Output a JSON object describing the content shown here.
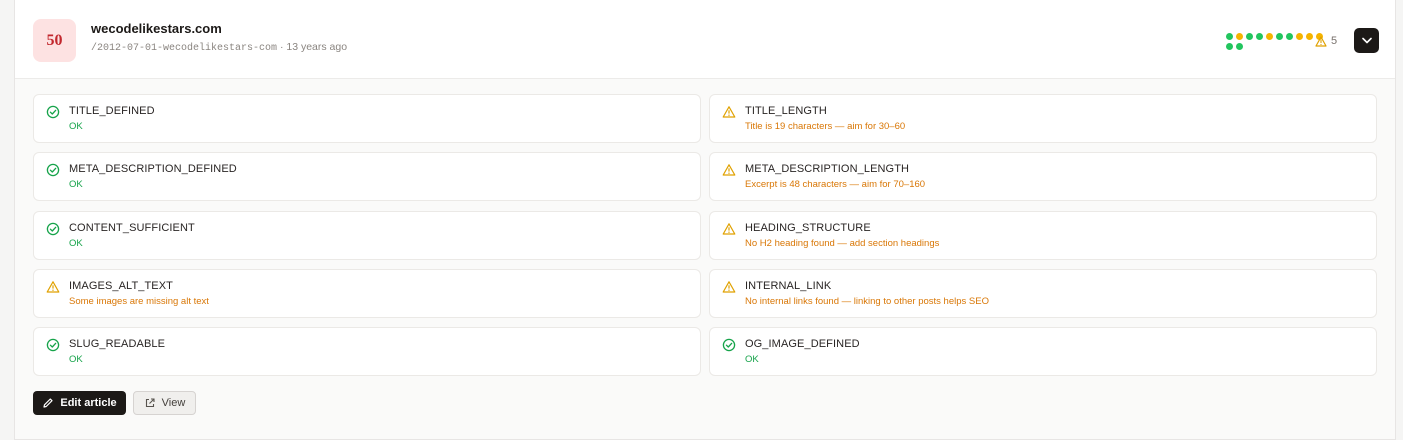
{
  "post": {
    "score": "50",
    "title": "wecodelikestars.com",
    "path": "/2012-07-01-wecodelikestars-com",
    "age": "· 13 years ago",
    "warning_count": "5"
  },
  "status_dots": [
    "ok",
    "warn",
    "ok",
    "ok",
    "warn",
    "ok",
    "ok",
    "warn",
    "warn",
    "warn",
    "ok",
    "ok"
  ],
  "colors": {
    "ok": "#22c55e",
    "warn": "#f5b400",
    "score_bg": "#fde2e2",
    "score_fg": "#c2272d"
  },
  "checks": [
    {
      "name": "TITLE_DEFINED",
      "status": "ok",
      "message": "OK"
    },
    {
      "name": "TITLE_LENGTH",
      "status": "warn",
      "message": "Title is 19 characters — aim for 30–60"
    },
    {
      "name": "META_DESCRIPTION_DEFINED",
      "status": "ok",
      "message": "OK"
    },
    {
      "name": "META_DESCRIPTION_LENGTH",
      "status": "warn",
      "message": "Excerpt is 48 characters — aim for 70–160"
    },
    {
      "name": "CONTENT_SUFFICIENT",
      "status": "ok",
      "message": "OK"
    },
    {
      "name": "HEADING_STRUCTURE",
      "status": "warn",
      "message": "No H2 heading found — add section headings"
    },
    {
      "name": "IMAGES_ALT_TEXT",
      "status": "warn",
      "message": "Some images are missing alt text"
    },
    {
      "name": "INTERNAL_LINK",
      "status": "warn",
      "message": "No internal links found — linking to other posts helps SEO"
    },
    {
      "name": "SLUG_READABLE",
      "status": "ok",
      "message": "OK"
    },
    {
      "name": "OG_IMAGE_DEFINED",
      "status": "ok",
      "message": "OK"
    }
  ],
  "actions": {
    "edit_label": "Edit article",
    "view_label": "View"
  },
  "icons": {
    "ok": "check-circle-icon",
    "warn": "warning-triangle-icon",
    "toggle": "chevron-down-icon",
    "edit": "pencil-icon",
    "view": "external-link-icon"
  }
}
